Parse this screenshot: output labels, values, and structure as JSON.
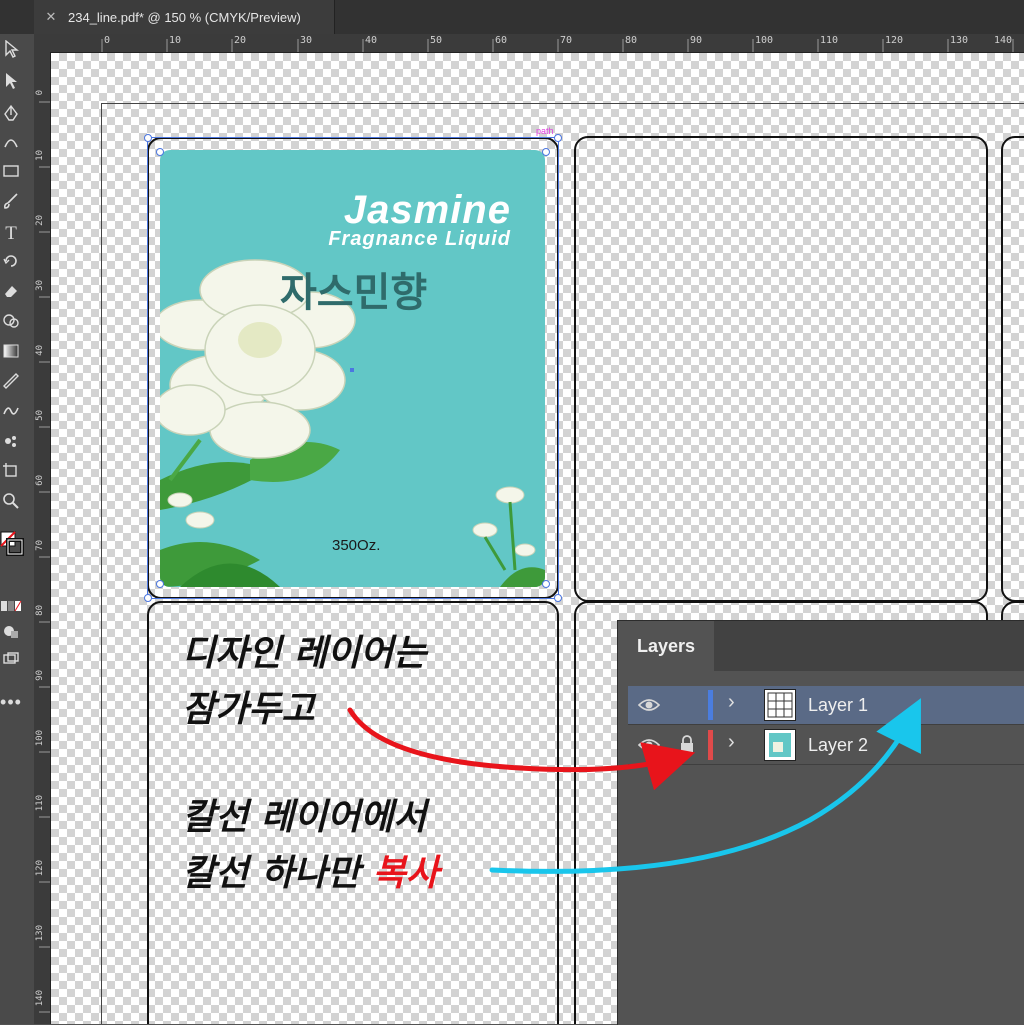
{
  "document_tab": {
    "close_symbol": "✕",
    "title": "234_line.pdf* @ 150 % (CMYK/Preview)"
  },
  "rulers": {
    "top_ticks": [
      "0",
      "10",
      "20",
      "30",
      "40",
      "50",
      "60",
      "70",
      "80",
      "90",
      "100",
      "110",
      "120",
      "130",
      "140"
    ],
    "left_ticks": [
      "0",
      "10",
      "20",
      "30",
      "40",
      "50",
      "60",
      "70",
      "80",
      "90",
      "100",
      "110",
      "120",
      "130",
      "140"
    ]
  },
  "tools": [
    "selection-icon",
    "direct-selection-icon",
    "pen-icon",
    "curvature-pen-icon",
    "rectangle-icon",
    "paintbrush-icon",
    "type-icon",
    "rotate-icon",
    "eraser-icon",
    "shape-builder-icon",
    "gradient-icon",
    "eyedropper-icon",
    "blend-icon",
    "symbol-sprayer-icon",
    "artboard-icon",
    "zoom-icon",
    "fill-stroke-icon",
    "color-mode-icon",
    "draw-mode-icon",
    "screen-mode-icon",
    "more-tools-icon"
  ],
  "label": {
    "brand_line1": "Jasmine",
    "brand_line2": "Fragnance Liquid",
    "korean_title": "자스민향",
    "volume": "350Oz.",
    "background_color": "#62c7c6"
  },
  "selection": {
    "path_tag": "path"
  },
  "annotations": {
    "line1": "디자인 레이어는",
    "line2": "잠가두고",
    "line3": "칼선 레이어에서",
    "line4_prefix": "칼선 하나만 ",
    "line4_highlight": "복사"
  },
  "layers_panel": {
    "tab_label": "Layers",
    "rows": [
      {
        "name": "Layer 1",
        "color": "#4a7de0",
        "locked": false,
        "selected": true
      },
      {
        "name": "Layer 2",
        "color": "#e04a4a",
        "locked": true,
        "selected": false
      }
    ]
  },
  "colors": {
    "red_arrow": "#e8141b",
    "cyan_arrow": "#19c6ec",
    "selection_blue": "#4b76e0"
  }
}
